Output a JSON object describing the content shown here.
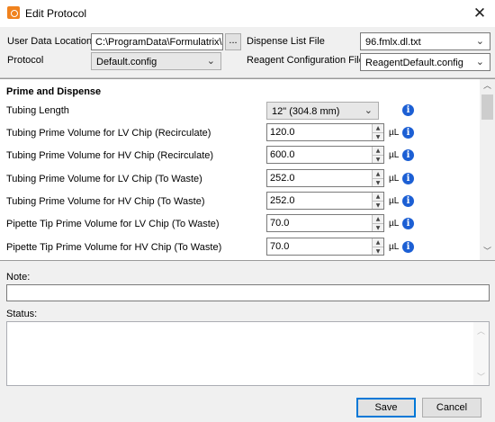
{
  "window": {
    "title": "Edit Protocol",
    "close_glyph": "✕",
    "icon": "app-logo-icon"
  },
  "header": {
    "user_data_location_label": "User Data Location",
    "user_data_location_value": "C:\\ProgramData\\Formulatrix\\Ter",
    "browse_label": "...",
    "dispense_list_label": "Dispense List File",
    "dispense_list_value": "96.fmlx.dl.txt",
    "protocol_label": "Protocol",
    "protocol_value": "Default.config",
    "reagent_config_label": "Reagent Configuration File",
    "reagent_config_value": "ReagentDefault.config"
  },
  "settings": {
    "section_title": "Prime and Dispense",
    "tubing_length_label": "Tubing Length",
    "tubing_length_value": "12\" (304.8 mm)",
    "rows": [
      {
        "label": "Tubing Prime Volume for LV Chip (Recirculate)",
        "value": "120.0",
        "unit": "µL"
      },
      {
        "label": "Tubing Prime Volume for HV Chip (Recirculate)",
        "value": "600.0",
        "unit": "µL"
      },
      {
        "label": "Tubing Prime Volume for LV Chip (To Waste)",
        "value": "252.0",
        "unit": "µL"
      },
      {
        "label": "Tubing Prime Volume for HV Chip (To Waste)",
        "value": "252.0",
        "unit": "µL"
      },
      {
        "label": "Pipette Tip Prime Volume for LV Chip (To Waste)",
        "value": "70.0",
        "unit": "µL"
      },
      {
        "label": "Pipette Tip Prime Volume for HV Chip (To Waste)",
        "value": "70.0",
        "unit": "µL"
      }
    ],
    "info_glyph": "i"
  },
  "note": {
    "label": "Note:",
    "value": ""
  },
  "status": {
    "label": "Status:",
    "value": ""
  },
  "buttons": {
    "save": "Save",
    "cancel": "Cancel"
  },
  "colors": {
    "accent": "#0078d7",
    "info": "#1c5fd4",
    "app_icon": "#f0821e"
  }
}
